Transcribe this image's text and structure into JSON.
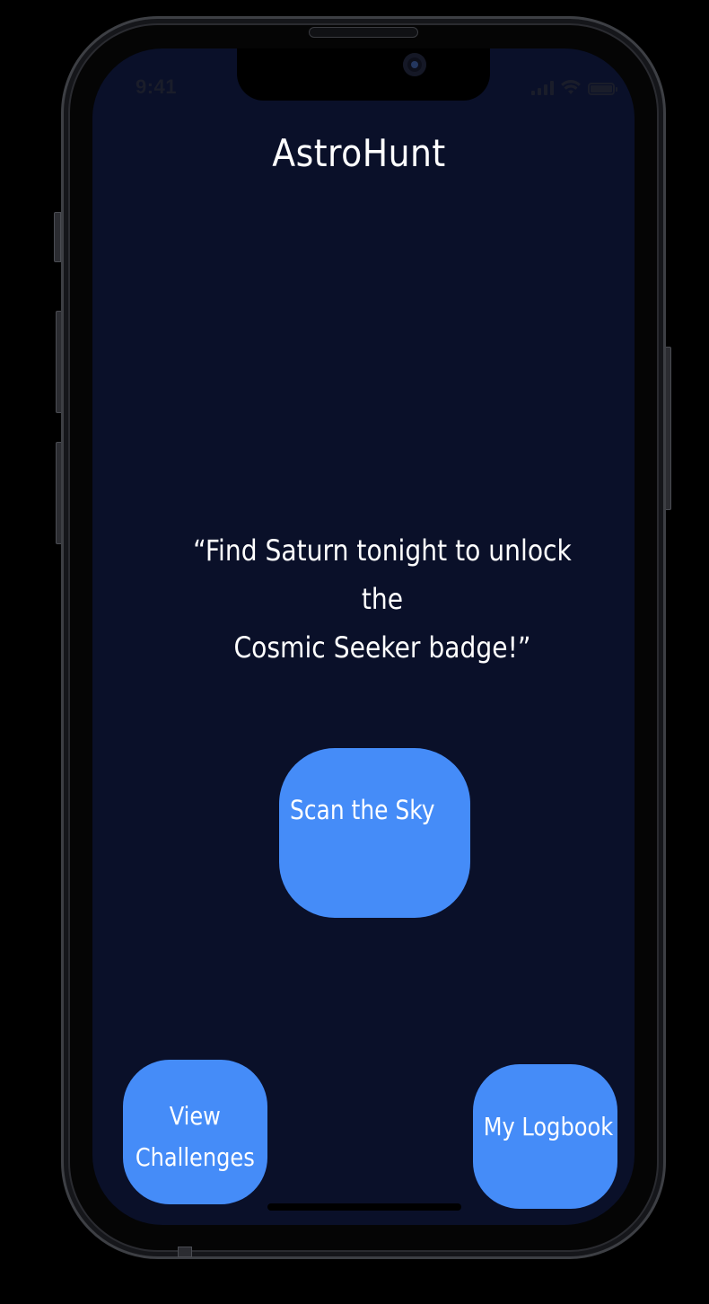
{
  "status_bar": {
    "time": "9:41"
  },
  "app": {
    "title": "AstroHunt"
  },
  "challenge": {
    "quote_line1": "“Find Saturn tonight to unlock the",
    "quote_line2": "Cosmic Seeker badge!”"
  },
  "actions": {
    "scan_label": "Scan the Sky",
    "challenges_line1": "View",
    "challenges_line2": "Challenges",
    "logbook_label": "My Logbook"
  },
  "colors": {
    "screen_background": "#0a1029",
    "button": "#458cf8",
    "text": "#ffffff"
  },
  "icons": {
    "signal": "cellular-signal-icon",
    "wifi": "wifi-icon",
    "battery": "battery-icon"
  }
}
